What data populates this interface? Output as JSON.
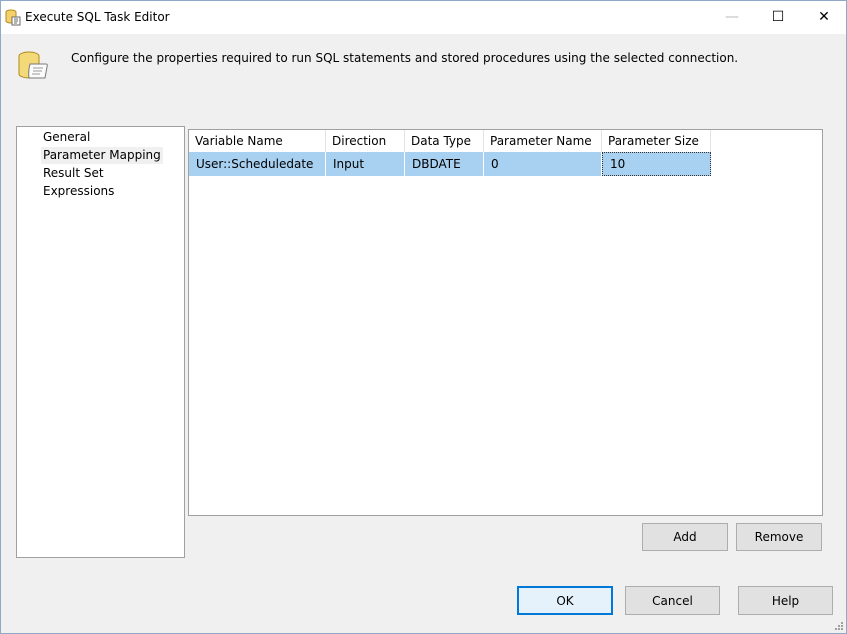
{
  "window": {
    "title": "Execute SQL Task Editor",
    "controls": {
      "minimize": "—",
      "maximize": "☐",
      "close": "✕"
    }
  },
  "header": {
    "description": "Configure the properties required to run SQL statements and stored procedures using the selected connection."
  },
  "nav": {
    "items": [
      {
        "label": "General",
        "selected": false
      },
      {
        "label": "Parameter Mapping",
        "selected": true
      },
      {
        "label": "Result Set",
        "selected": false
      },
      {
        "label": "Expressions",
        "selected": false
      }
    ]
  },
  "grid": {
    "columns": [
      "Variable Name",
      "Direction",
      "Data Type",
      "Parameter Name",
      "Parameter Size"
    ],
    "rows": [
      [
        "User::Scheduledate",
        "Input",
        "DBDATE",
        "0",
        "10"
      ]
    ]
  },
  "buttons": {
    "add": "Add",
    "remove": "Remove",
    "ok": "OK",
    "cancel": "Cancel",
    "help": "Help"
  },
  "colors": {
    "selection": "#a8d0f0",
    "accent": "#0078d7"
  }
}
